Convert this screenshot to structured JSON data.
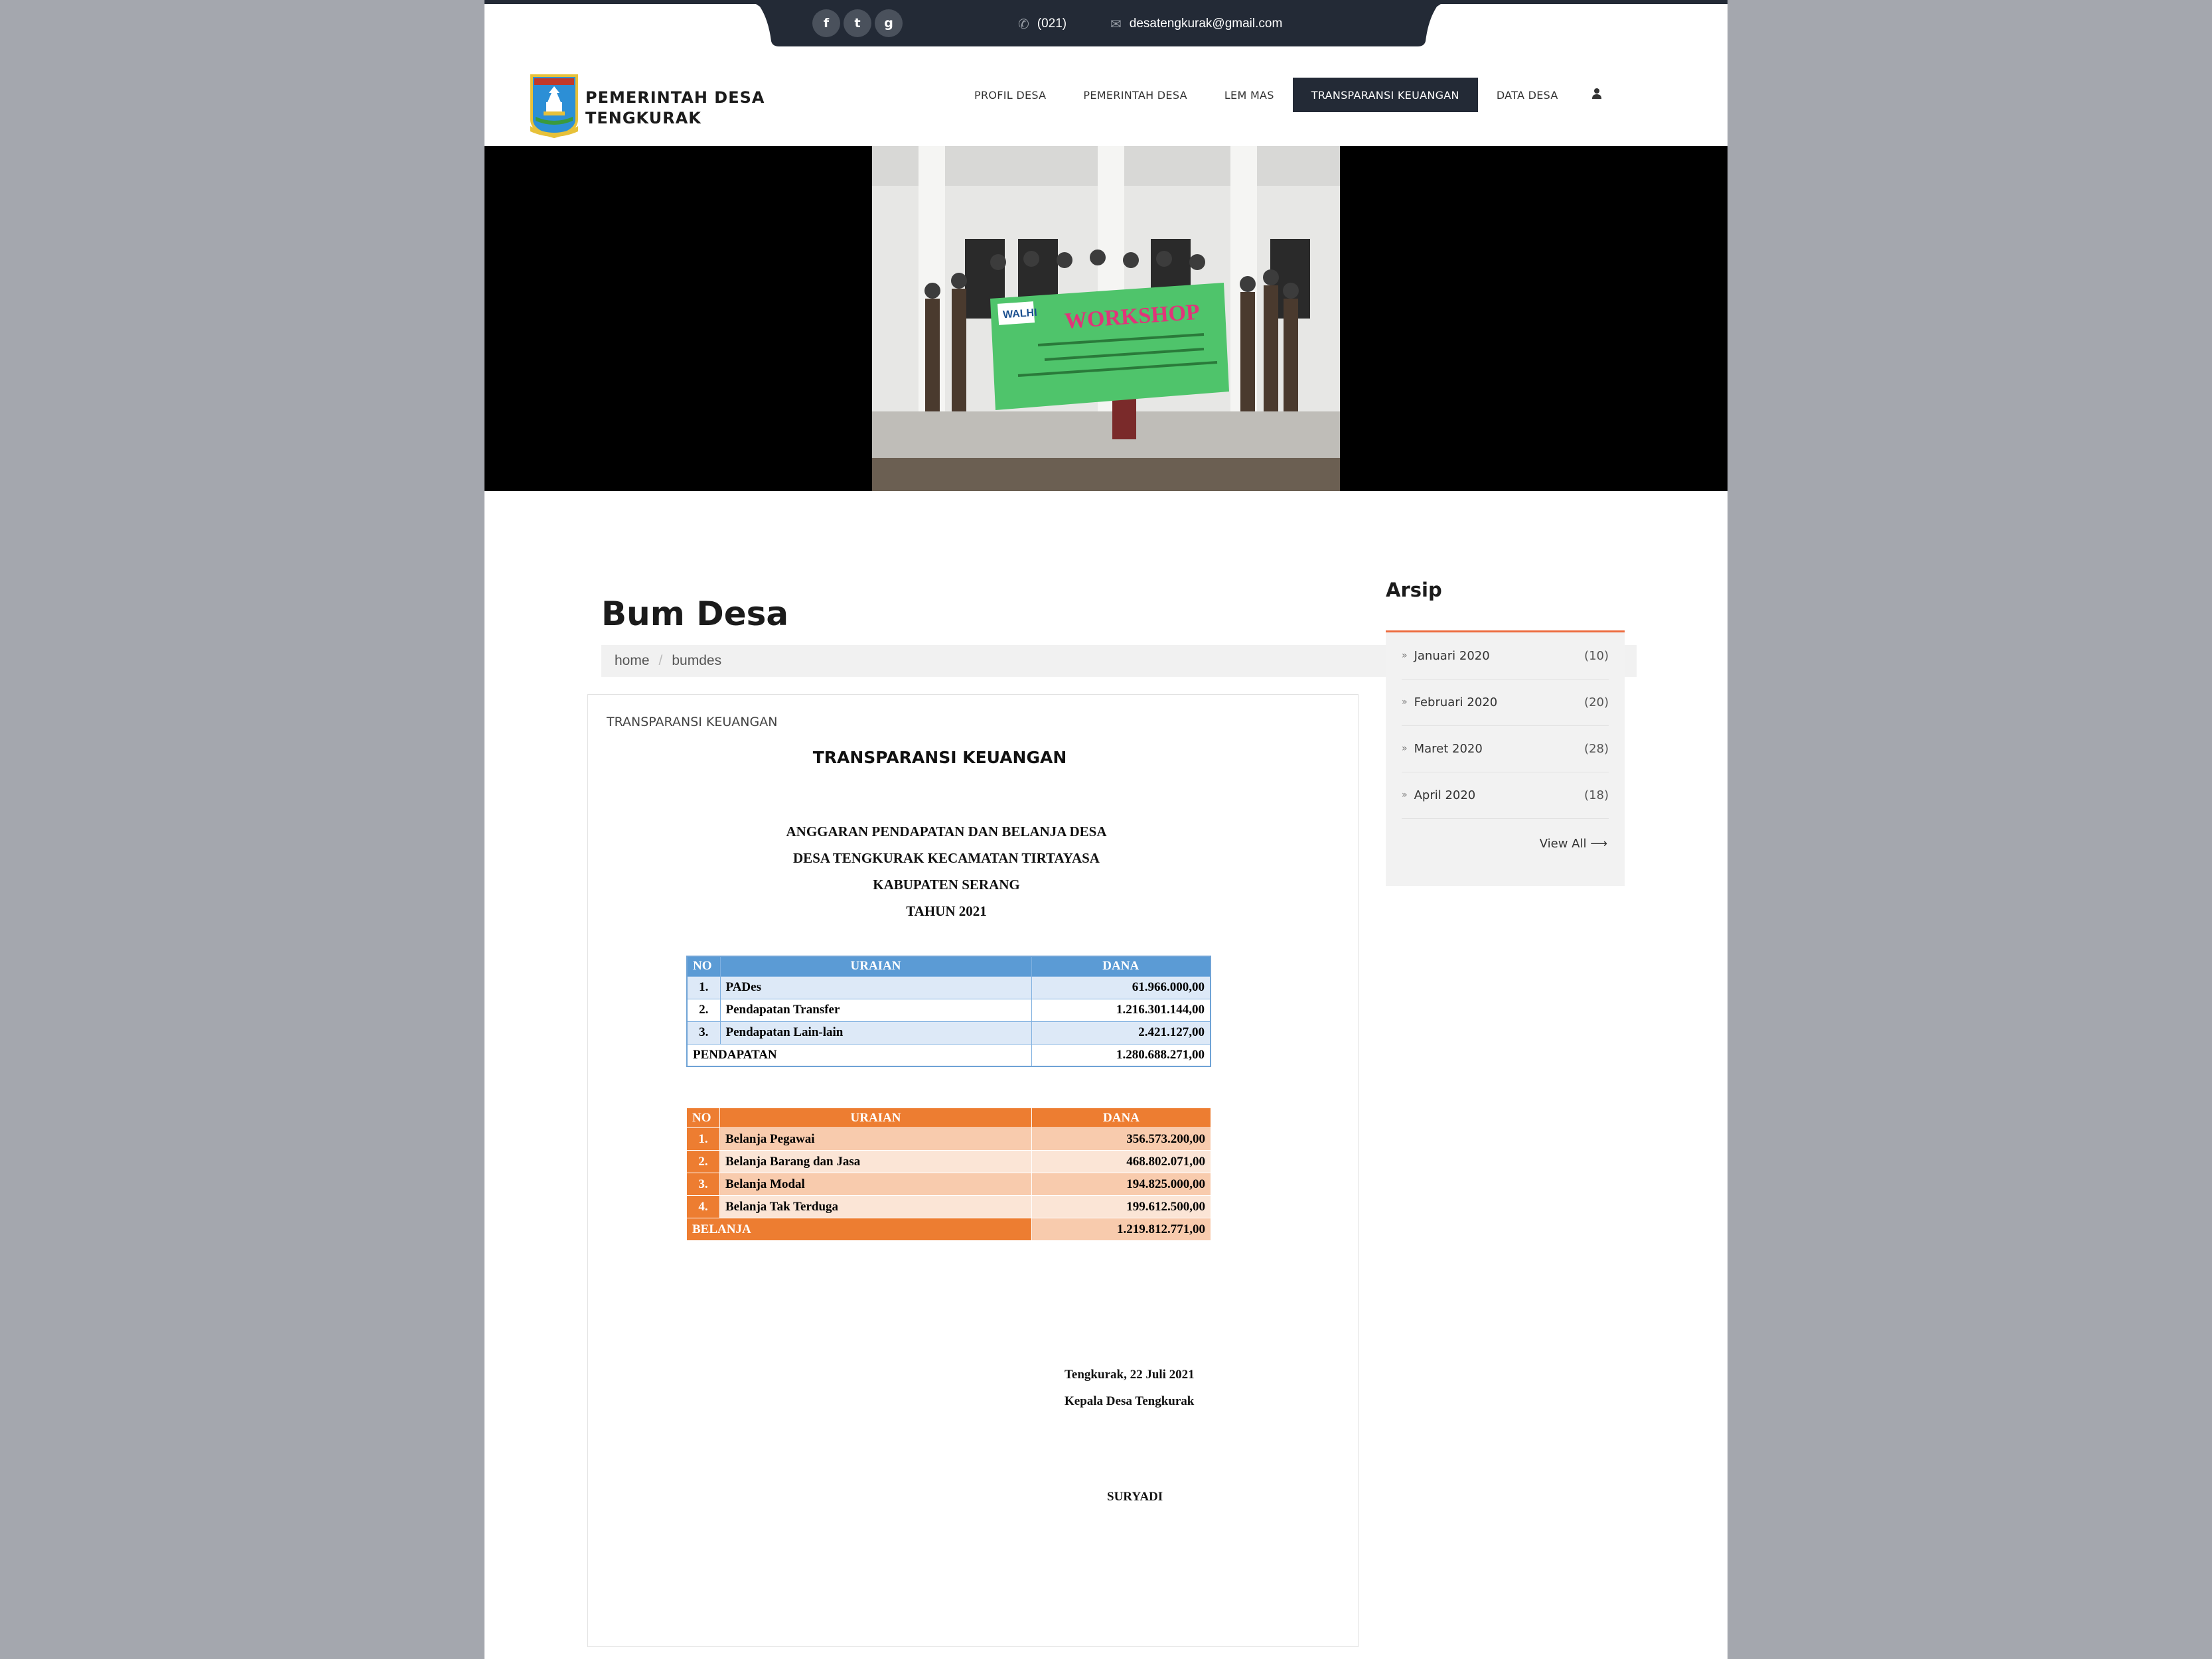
{
  "topbar": {
    "social": [
      {
        "icon": "facebook-icon",
        "glyph": "f"
      },
      {
        "icon": "twitter-icon",
        "glyph": "t"
      },
      {
        "icon": "google-plus-icon",
        "glyph": "g"
      }
    ],
    "phone": "(021)",
    "email": "desatengkurak@gmail.com"
  },
  "brand": {
    "line1": "PEMERINTAH DESA",
    "line2": "TENGKURAK"
  },
  "nav": {
    "items": [
      "PROFIL DESA",
      "PEMERINTAH DESA",
      "LEM MAS",
      "TRANSPARANSI KEUANGAN",
      "DATA DESA"
    ],
    "active": "TRANSPARANSI KEUANGAN",
    "user_icon": "user-icon"
  },
  "hero": {
    "banner_text": "WORKSHOP",
    "banner_tag": "WALHI"
  },
  "page": {
    "title": "Bum Desa",
    "breadcrumb": [
      "home",
      "bumdes"
    ]
  },
  "article": {
    "category": "TRANSPARANSI KEUANGAN",
    "heading": "TRANSPARANSI KEUANGAN",
    "doc_head": [
      "ANGGARAN PENDAPATAN DAN BELANJA DESA",
      "DESA TENGKURAK KECAMATAN TIRTAYASA",
      "KABUPATEN SERANG",
      "TAHUN 2021"
    ],
    "pendapatan": {
      "headers": [
        "NO",
        "URAIAN",
        "DANA"
      ],
      "rows": [
        {
          "no": "1.",
          "uraian": "PADes",
          "dana": "61.966.000,00"
        },
        {
          "no": "2.",
          "uraian": "Pendapatan Transfer",
          "dana": "1.216.301.144,00"
        },
        {
          "no": "3.",
          "uraian": "Pendapatan Lain-lain",
          "dana": "2.421.127,00"
        }
      ],
      "total_label": "PENDAPATAN",
      "total": "1.280.688.271,00"
    },
    "belanja": {
      "headers": [
        "NO",
        "URAIAN",
        "DANA"
      ],
      "rows": [
        {
          "no": "1.",
          "uraian": "Belanja Pegawai",
          "dana": "356.573.200,00"
        },
        {
          "no": "2.",
          "uraian": "Belanja Barang dan Jasa",
          "dana": "468.802.071,00"
        },
        {
          "no": "3.",
          "uraian": "Belanja Modal",
          "dana": "194.825.000,00"
        },
        {
          "no": "4.",
          "uraian": "Belanja Tak Terduga",
          "dana": "199.612.500,00"
        }
      ],
      "total_label": "BELANJA",
      "total": "1.219.812.771,00"
    },
    "signature": {
      "place_date": "Tengkurak, 22 Juli 2021",
      "role": "Kepala Desa Tengkurak",
      "name": "SURYADI"
    }
  },
  "sidebar": {
    "title": "Arsip",
    "items": [
      {
        "label": "Januari 2020",
        "count": "(10)"
      },
      {
        "label": "Februari 2020",
        "count": "(20)"
      },
      {
        "label": "Maret 2020",
        "count": "(28)"
      },
      {
        "label": "April 2020",
        "count": "(18)"
      }
    ],
    "view_all": "View All ⟶"
  },
  "colors": {
    "dark": "#232a36",
    "accent_orange": "#ed7d31",
    "accent_blue": "#5b9bd5",
    "sidebar_line": "#ed6b3e"
  }
}
